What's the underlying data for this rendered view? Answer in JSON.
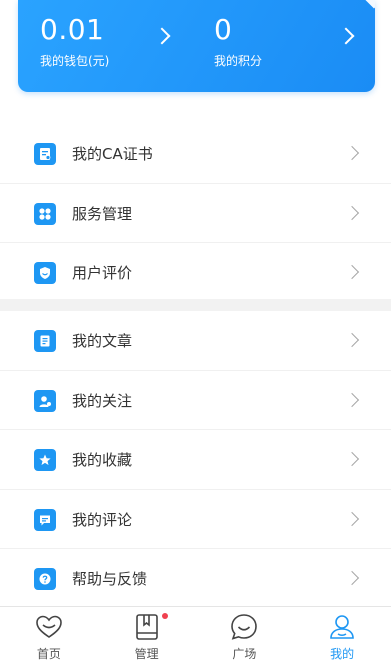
{
  "top_card": {
    "wallet": {
      "value": "0.01",
      "label": "我的钱包(元)"
    },
    "points": {
      "value": "0",
      "label": "我的积分"
    }
  },
  "group1": [
    {
      "label": "我的CA证书",
      "icon": "certificate-icon"
    },
    {
      "label": "服务管理",
      "icon": "grid-icon"
    },
    {
      "label": "用户评价",
      "icon": "shield-icon"
    }
  ],
  "group2": [
    {
      "label": "我的文章",
      "icon": "document-icon"
    },
    {
      "label": "我的关注",
      "icon": "user-icon"
    },
    {
      "label": "我的收藏",
      "icon": "star-icon"
    },
    {
      "label": "我的评论",
      "icon": "comment-icon"
    },
    {
      "label": "帮助与反馈",
      "icon": "help-icon"
    }
  ],
  "tabs": [
    {
      "label": "首页",
      "icon": "heart-icon",
      "active": false,
      "badge": false
    },
    {
      "label": "管理",
      "icon": "book-icon",
      "active": false,
      "badge": true
    },
    {
      "label": "广场",
      "icon": "chat-bubble-icon",
      "active": false,
      "badge": false
    },
    {
      "label": "我的",
      "icon": "person-icon",
      "active": true,
      "badge": false
    }
  ],
  "colors": {
    "accent": "#1e97f3",
    "badge": "#f0404f",
    "text": "#333333"
  }
}
